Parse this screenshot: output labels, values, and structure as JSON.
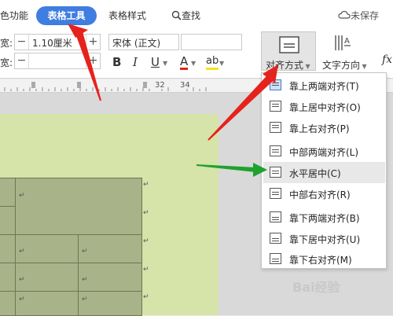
{
  "tabs": {
    "prev_partial": "色功能",
    "active": "表格工具",
    "style": "表格样式",
    "search": "查找",
    "unsaved": "未保存"
  },
  "ribbon": {
    "width_label": "宽:",
    "height_label": "宽:",
    "width_value": "1.10厘米",
    "height_value": "",
    "font_name": "宋体 (正文)",
    "bold": "B",
    "italic": "I",
    "underline": "U",
    "font_color": "A",
    "highlight": "ab",
    "align_label": "对齐方式",
    "text_dir_label": "文字方向",
    "fx_label": "fx"
  },
  "ruler": {
    "marks": [
      "32",
      "34"
    ]
  },
  "menu": {
    "items": [
      {
        "label": "靠上两端对齐(T)",
        "highlighted": true
      },
      {
        "label": "靠上居中对齐(O)",
        "highlighted": false
      },
      {
        "label": "靠上右对齐(P)",
        "highlighted": false
      },
      {
        "label": "中部两端对齐(L)",
        "highlighted": false
      },
      {
        "label": "水平居中(C)",
        "highlighted": true
      },
      {
        "label": "中部右对齐(R)",
        "highlighted": false
      },
      {
        "label": "靠下两端对齐(B)",
        "highlighted": false
      },
      {
        "label": "靠下居中对齐(U)",
        "highlighted": false
      },
      {
        "label": "靠下右对齐(M)",
        "highlighted": false
      }
    ]
  },
  "table": {
    "paragraph_mark": "↵"
  },
  "watermark": "Bai经验",
  "colors": {
    "accent": "#3f7de0",
    "page": "#d6e3a9",
    "cell": "#a8b389",
    "red_arrow": "#e5231c",
    "green_arrow": "#1fa22e"
  }
}
